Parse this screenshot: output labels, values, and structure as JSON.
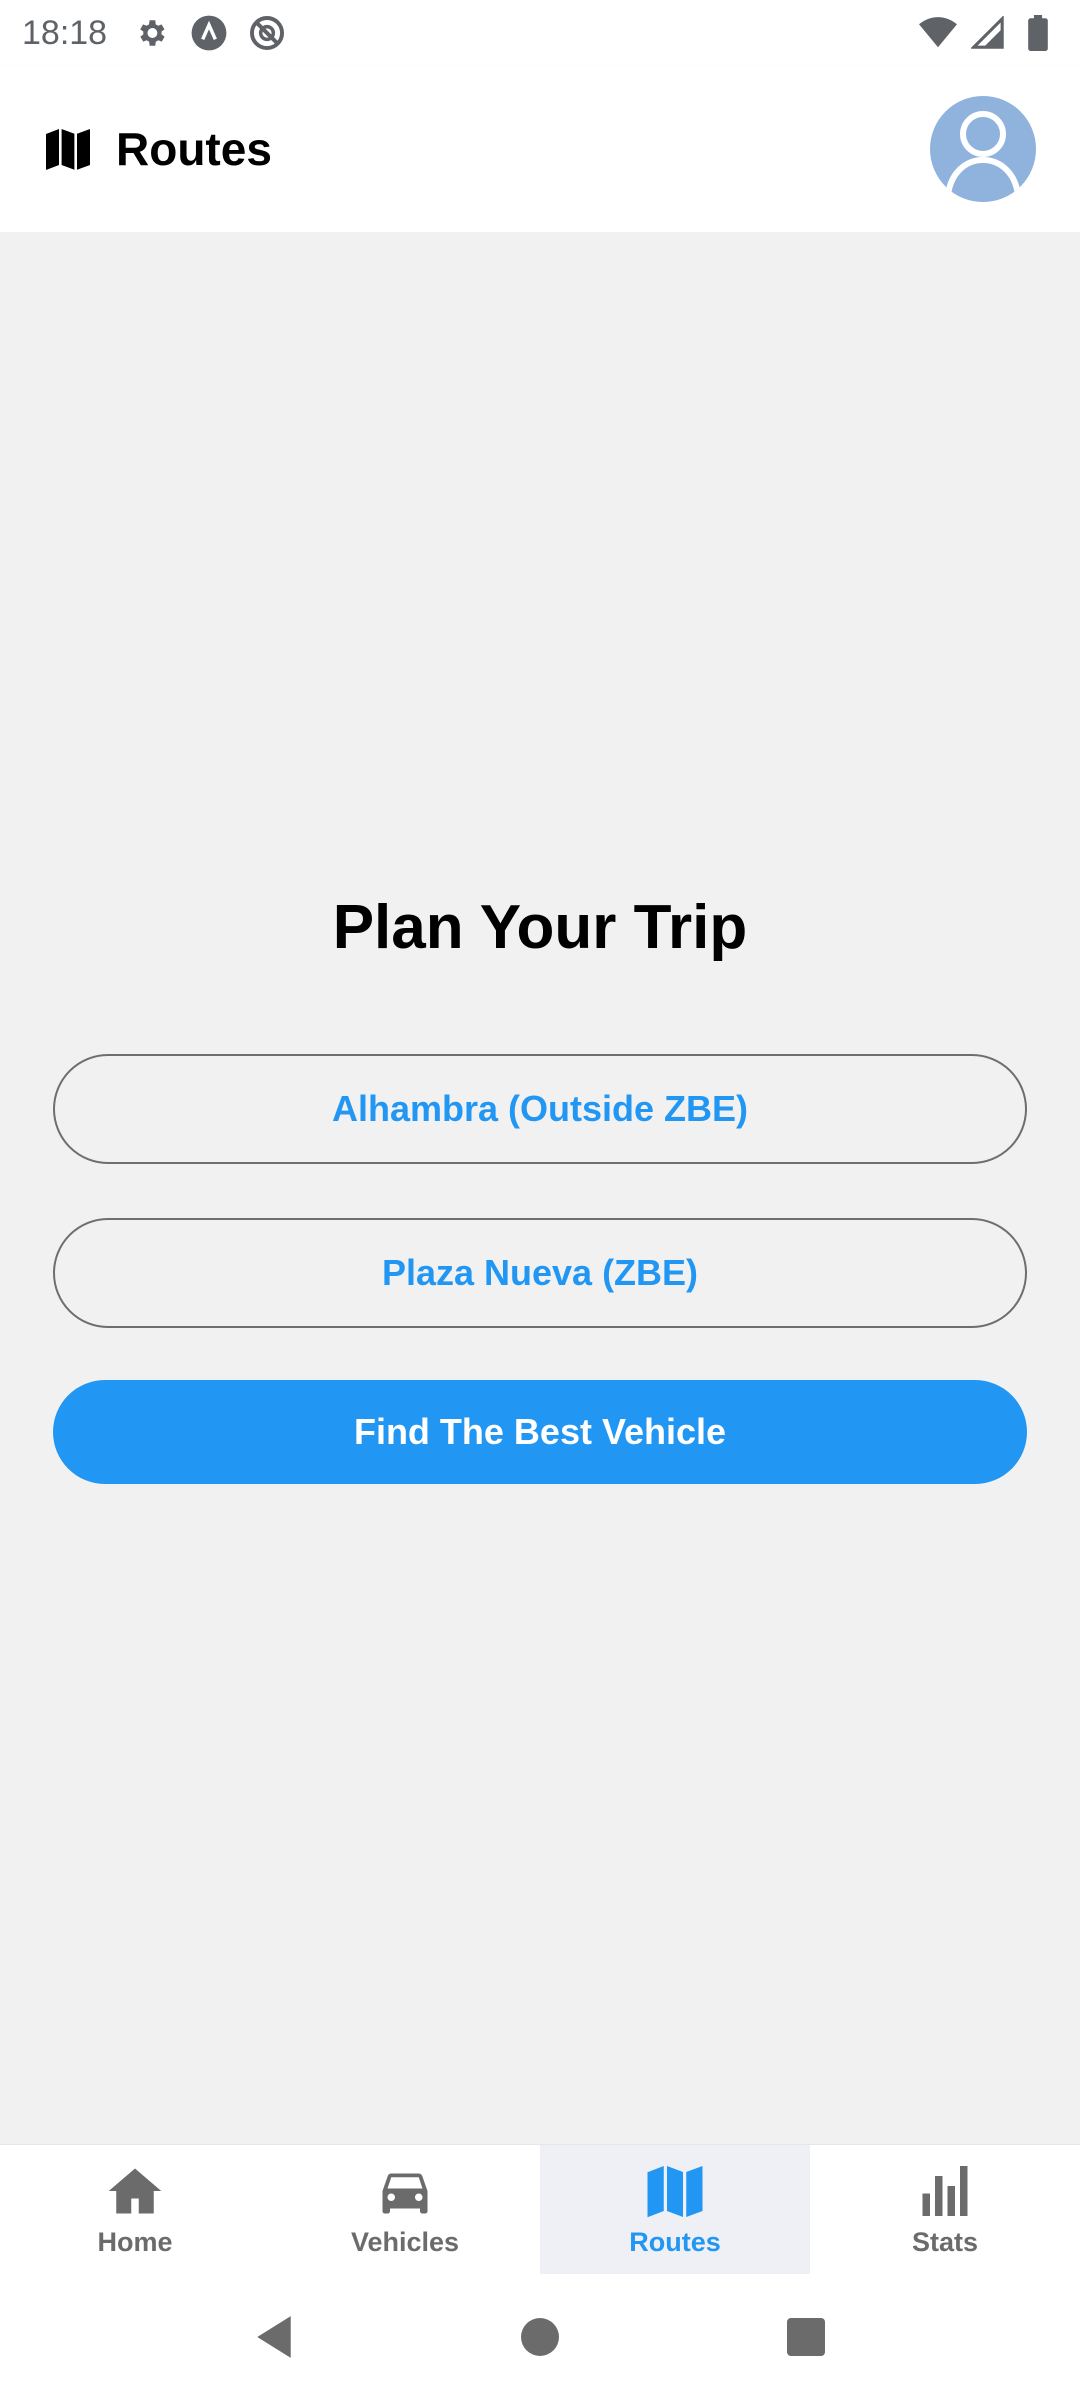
{
  "status_bar": {
    "time": "18:18",
    "left_icons": [
      "gear-icon",
      "a-circle-icon",
      "no-sync-icon"
    ],
    "right_icons": [
      "wifi-icon",
      "signal-icon",
      "battery-icon"
    ]
  },
  "header": {
    "icon": "map-icon",
    "title": "Routes",
    "avatar_icon": "user-avatar-icon"
  },
  "main": {
    "title": "Plan Your Trip",
    "origin_label": "Alhambra (Outside ZBE)",
    "destination_label": "Plaza Nueva (ZBE)",
    "find_button_label": "Find The Best Vehicle"
  },
  "bottom_nav": {
    "items": [
      {
        "label": "Home",
        "icon": "home-icon",
        "active": false
      },
      {
        "label": "Vehicles",
        "icon": "car-icon",
        "active": false
      },
      {
        "label": "Routes",
        "icon": "map-icon",
        "active": true
      },
      {
        "label": "Stats",
        "icon": "bar-chart-icon",
        "active": false
      }
    ]
  },
  "system_nav": {
    "buttons": [
      "back-icon",
      "home-circle-icon",
      "recents-icon"
    ]
  },
  "colors": {
    "accent": "#2196f3",
    "background": "#f1f1f2",
    "avatar": "#8fb3dd",
    "inactive": "#6b6b6b"
  }
}
